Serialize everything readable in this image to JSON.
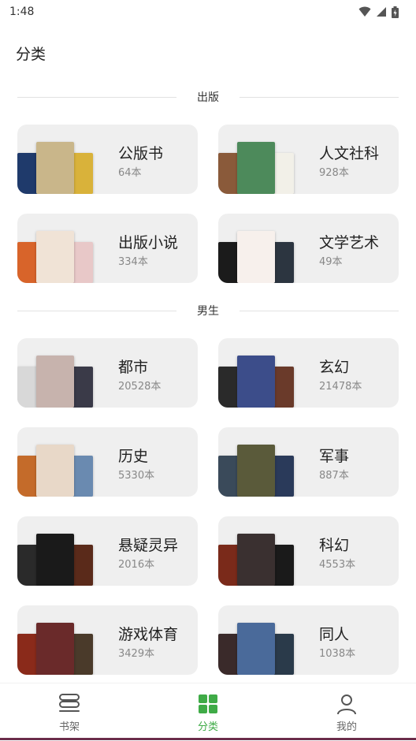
{
  "status_bar": {
    "time": "1:48"
  },
  "page": {
    "title": "分类"
  },
  "sections": [
    {
      "label": "出版",
      "cards": [
        {
          "name": "公版书",
          "count": "64本",
          "covers": [
            "#1f3a6b",
            "#c9b68a",
            "#d9b23a"
          ]
        },
        {
          "name": "人文社科",
          "count": "928本",
          "covers": [
            "#8a5a3a",
            "#4d8a5b",
            "#f2f0e8"
          ]
        },
        {
          "name": "出版小说",
          "count": "334本",
          "covers": [
            "#d8642a",
            "#f0e3d6",
            "#e8c8c8"
          ]
        },
        {
          "name": "文学艺术",
          "count": "49本",
          "covers": [
            "#1b1b1b",
            "#f7f0ec",
            "#2c3540"
          ]
        }
      ]
    },
    {
      "label": "男生",
      "cards": [
        {
          "name": "都市",
          "count": "20528本",
          "covers": [
            "#d8d8d8",
            "#c7b3ad",
            "#3a3a48"
          ]
        },
        {
          "name": "玄幻",
          "count": "21478本",
          "covers": [
            "#2a2a2a",
            "#3c4d8a",
            "#6a3a2a"
          ]
        },
        {
          "name": "历史",
          "count": "5330本",
          "covers": [
            "#c46b2a",
            "#e8d8c8",
            "#6a8ab0"
          ]
        },
        {
          "name": "军事",
          "count": "887本",
          "covers": [
            "#3a4a5a",
            "#5a5a3a",
            "#2a3a5a"
          ]
        },
        {
          "name": "悬疑灵异",
          "count": "2016本",
          "covers": [
            "#2a2a2a",
            "#1a1a1a",
            "#5a2a1a"
          ]
        },
        {
          "name": "科幻",
          "count": "4553本",
          "covers": [
            "#7a2a1a",
            "#3a3030",
            "#1a1a1a"
          ]
        },
        {
          "name": "游戏体育",
          "count": "3429本",
          "covers": [
            "#8a2a1a",
            "#6a2a2a",
            "#4a3a2a"
          ]
        },
        {
          "name": "同人",
          "count": "1038本",
          "covers": [
            "#3a2a2a",
            "#4a6a9a",
            "#2a3a4a"
          ]
        }
      ]
    }
  ],
  "bottom_nav": {
    "items": [
      {
        "label": "书架",
        "icon": "bookshelf-icon",
        "active": false
      },
      {
        "label": "分类",
        "icon": "grid-icon",
        "active": true
      },
      {
        "label": "我的",
        "icon": "person-icon",
        "active": false
      }
    ],
    "colors": {
      "active": "#3fab47",
      "inactive": "#666666"
    }
  }
}
